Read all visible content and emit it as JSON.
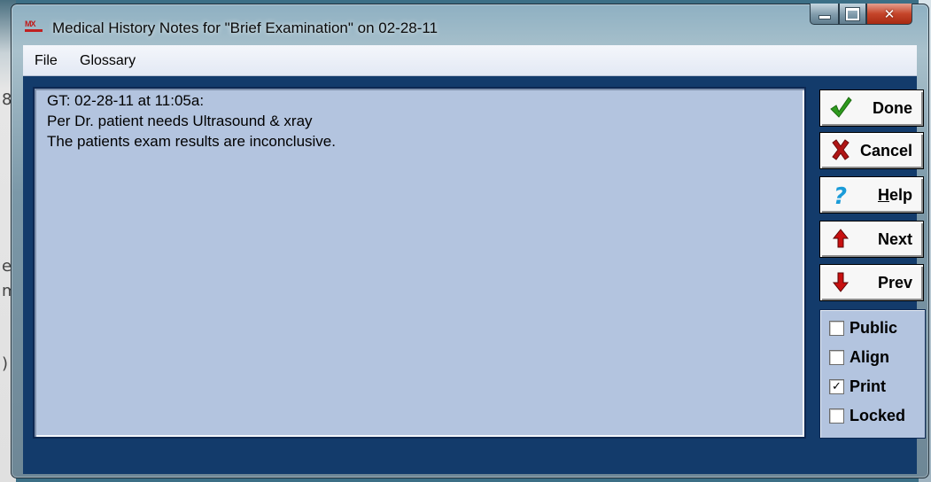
{
  "window": {
    "title": "Medical History Notes for \"Brief Examination\" on 02-28-11",
    "app_icon_text": "MX"
  },
  "background": {
    "left_fragments": [
      "8",
      "e",
      "m",
      ")"
    ]
  },
  "menu": {
    "file": "File",
    "glossary": "Glossary"
  },
  "notes": {
    "lines": [
      "GT: 02-28-11 at 11:05a:",
      "Per Dr. patient needs Ultrasound & xray",
      "The patients exam results are inconclusive."
    ]
  },
  "buttons": {
    "done": "Done",
    "cancel": "Cancel",
    "help_underlined": "H",
    "help_rest": "elp",
    "next": "Next",
    "prev": "Prev"
  },
  "checkboxes": [
    {
      "label": "Public",
      "checked": false,
      "mark": ""
    },
    {
      "label": "Align",
      "checked": false,
      "mark": ""
    },
    {
      "label": "Print",
      "checked": true,
      "mark": "✓"
    },
    {
      "label": "Locked",
      "checked": false,
      "mark": ""
    }
  ],
  "colors": {
    "client_bg": "#133b6b",
    "notes_bg": "#b3c4df",
    "done_check": "#2e9a1e",
    "cancel_x": "#b01515",
    "help_q": "#1a9bd8",
    "arrow": "#c81010"
  }
}
